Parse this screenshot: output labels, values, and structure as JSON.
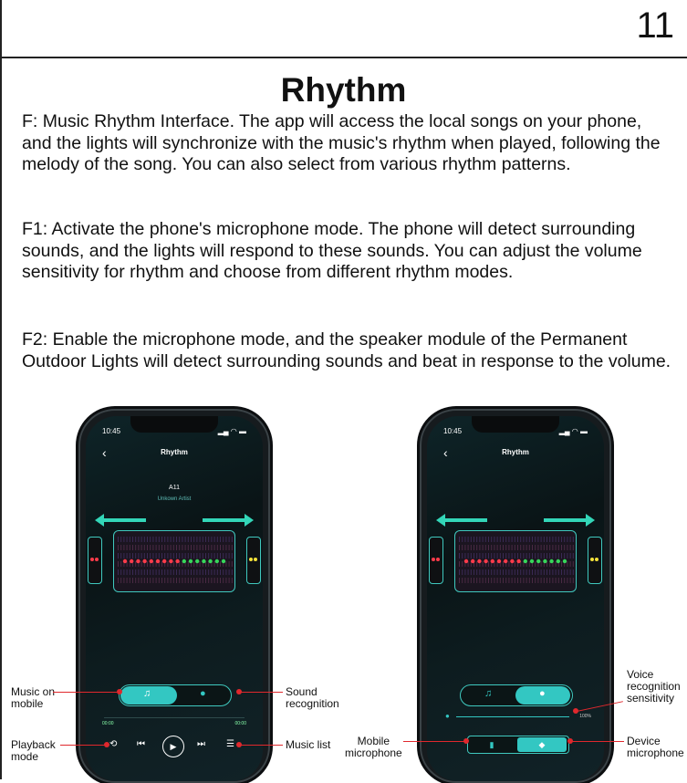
{
  "page_number": "11",
  "title": "Rhythm",
  "paragraphs": [
    "F: Music Rhythm Interface. The app will access the local songs on your phone, and the lights will synchronize with the music's rhythm when played, following the melody of the song. You can also select from various rhythm patterns.",
    "F1: Activate the phone's microphone mode. The phone will detect surrounding sounds, and the lights will respond to these sounds. You can adjust the volume sensitivity for rhythm and choose from different rhythm modes.",
    "F2: Enable the microphone mode, and the speaker module of the Permanent Outdoor Lights will detect surrounding sounds and beat in response to the volume."
  ],
  "phone1": {
    "status_time": "10:45",
    "screen_title": "Rhythm",
    "song_name": "A11",
    "song_artist": "Unkown Artist",
    "time_start": "00:00",
    "time_end": "00:00",
    "callouts": {
      "music_on_mobile": "Music on\nmobile",
      "sound_recognition": "Sound\nrecognition",
      "playback_mode": "Playback\nmode",
      "music_list": "Music list"
    }
  },
  "phone2": {
    "status_time": "10:45",
    "screen_title": "Rhythm",
    "sensitivity_value": "100%",
    "callouts": {
      "voice_recognition_sensitivity": "Voice\nrecognition\nsensitivity",
      "mobile_microphone": "Mobile\nmicrophone",
      "device_microphone": "Device\nmicrophone"
    }
  },
  "colors": {
    "accent": "#33c7c2",
    "callout_line": "#e0282d",
    "led_red": "#ff3b4a",
    "led_green": "#36d65a",
    "led_yellow": "#f5e23a"
  }
}
